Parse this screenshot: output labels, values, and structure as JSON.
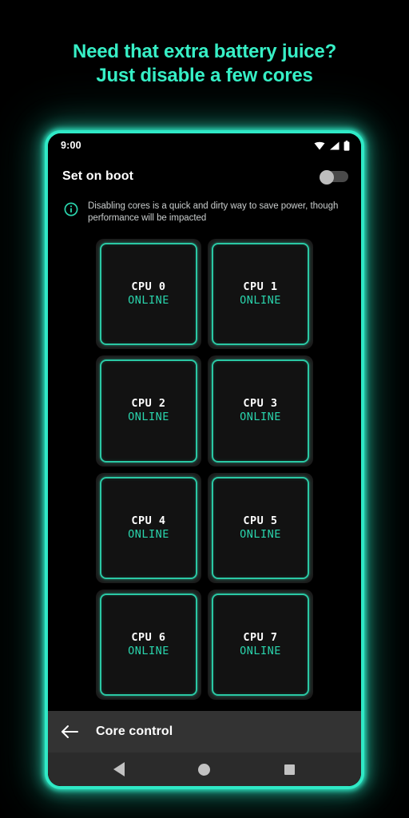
{
  "headline": {
    "line1": "Need that extra battery juice?",
    "line2": "Just disable a few cores",
    "color": "#37efc6"
  },
  "status_bar": {
    "time": "9:00",
    "icons": [
      "wifi-icon",
      "signal-icon",
      "battery-icon"
    ]
  },
  "boot_setting": {
    "label": "Set on boot",
    "toggle_state": "off"
  },
  "hint": {
    "icon": "info-icon",
    "text": "Disabling cores is a quick and dirty way to save power, though performance will be impacted",
    "icon_color": "#2ad5ad",
    "text_color": "#c9cdcd"
  },
  "cores": [
    {
      "name": "CPU 0",
      "state": "ONLINE",
      "online": true
    },
    {
      "name": "CPU 1",
      "state": "ONLINE",
      "online": true
    },
    {
      "name": "CPU 2",
      "state": "ONLINE",
      "online": true
    },
    {
      "name": "CPU 3",
      "state": "ONLINE",
      "online": true
    },
    {
      "name": "CPU 4",
      "state": "ONLINE",
      "online": true
    },
    {
      "name": "CPU 5",
      "state": "ONLINE",
      "online": true
    },
    {
      "name": "CPU 6",
      "state": "ONLINE",
      "online": true
    },
    {
      "name": "CPU 7",
      "state": "ONLINE",
      "online": true
    }
  ],
  "app_bar": {
    "back_icon": "arrow-left-icon",
    "title": "Core control"
  },
  "nav_bar": {
    "back": "back-triangle-icon",
    "home": "home-circle-icon",
    "recents": "recents-square-icon"
  },
  "theme": {
    "accent": "#2ac8a4",
    "accent_bright": "#2fe9c6",
    "online_text": "#2ad5ad",
    "background": "#000000",
    "app_bar_bg": "#333333",
    "nav_bar_bg": "#2b2b2b"
  }
}
